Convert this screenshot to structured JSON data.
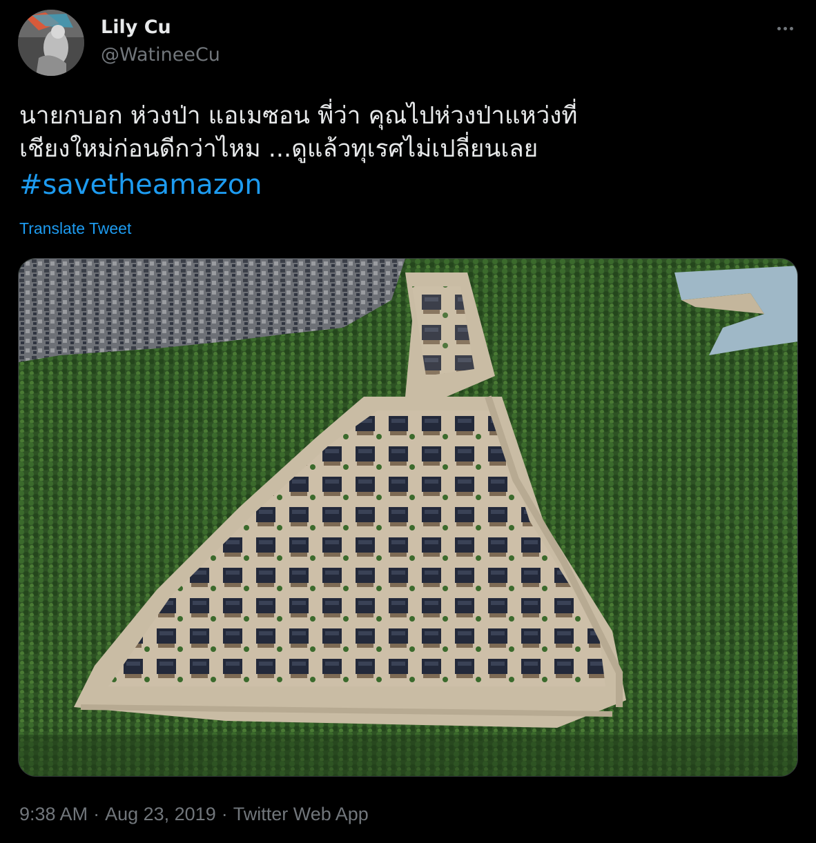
{
  "author": {
    "name": "Lily Cu",
    "handle": "@WatineeCu"
  },
  "tweet": {
    "line1": "นายกบอก ห่วงป่า แอเมซอน  พี่ว่า คุณไปห่วงป่าแหว่งที่",
    "line2": "เชียงใหม่ก่อนดีกว่าไหม ...ดูแล้วทุเรศไม่เปลี่ยนเลย",
    "hashtag": "#savetheamazon",
    "translate_label": "Translate Tweet"
  },
  "media": {
    "description_icon": "aerial-photo"
  },
  "meta": {
    "time": "9:38 AM",
    "separator": "·",
    "date": "Aug 23, 2019",
    "source": "Twitter Web App"
  },
  "colors": {
    "background": "#000000",
    "text": "#e7e9ea",
    "secondary": "#71767b",
    "link": "#1d9bf0"
  },
  "icons": {
    "more": "more-dots-icon"
  }
}
